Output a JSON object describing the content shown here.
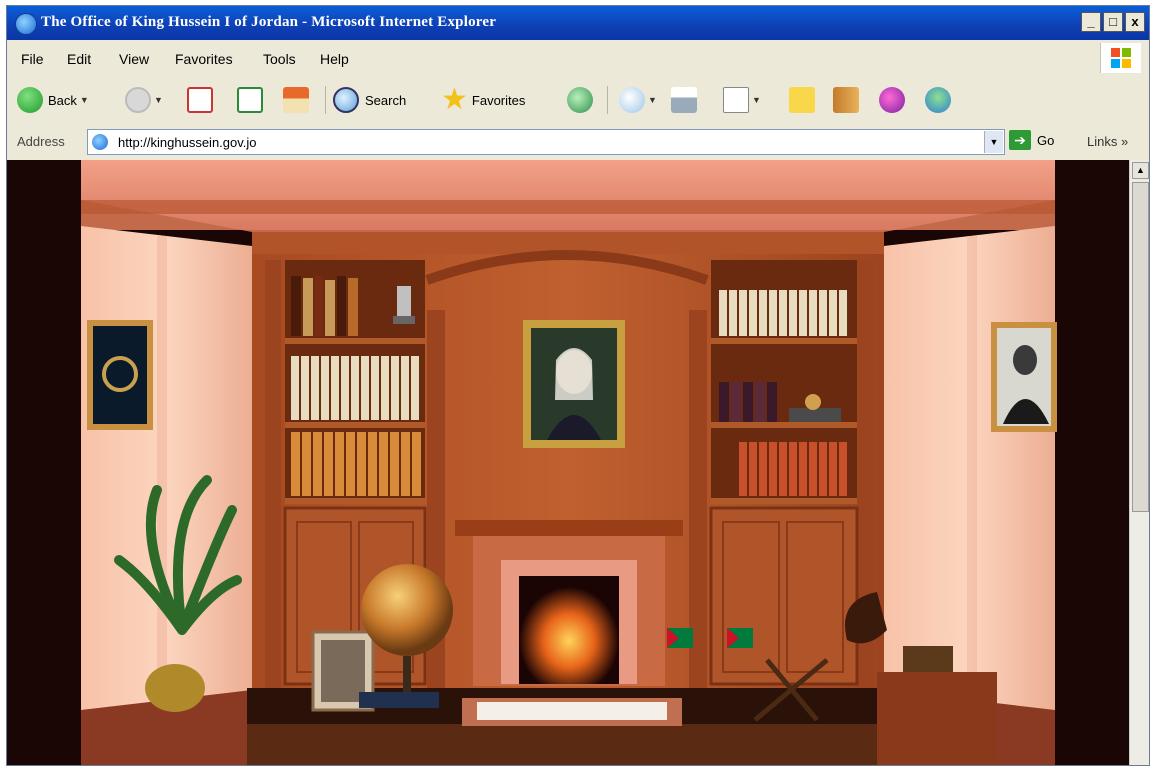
{
  "window": {
    "title": "The Office of King Hussein I of Jordan - Microsoft Internet Explorer",
    "controls": [
      "_",
      "□",
      "x"
    ]
  },
  "menu": [
    "File",
    "Edit",
    "View",
    "Favorites",
    "Tools",
    "Help"
  ],
  "toolbar": {
    "back_label": "Back",
    "search_label": "Search",
    "favorites_label": "Favorites"
  },
  "address": {
    "label": "Address",
    "url": "http://kinghussein.gov.jo",
    "go_label": "Go",
    "links_label": "Links",
    "links_chevron": "»"
  },
  "colors": {
    "wall": "#f0b49a",
    "wood": "#b4552c",
    "ceiling": "#e48c72",
    "desk": "#2a1208"
  }
}
